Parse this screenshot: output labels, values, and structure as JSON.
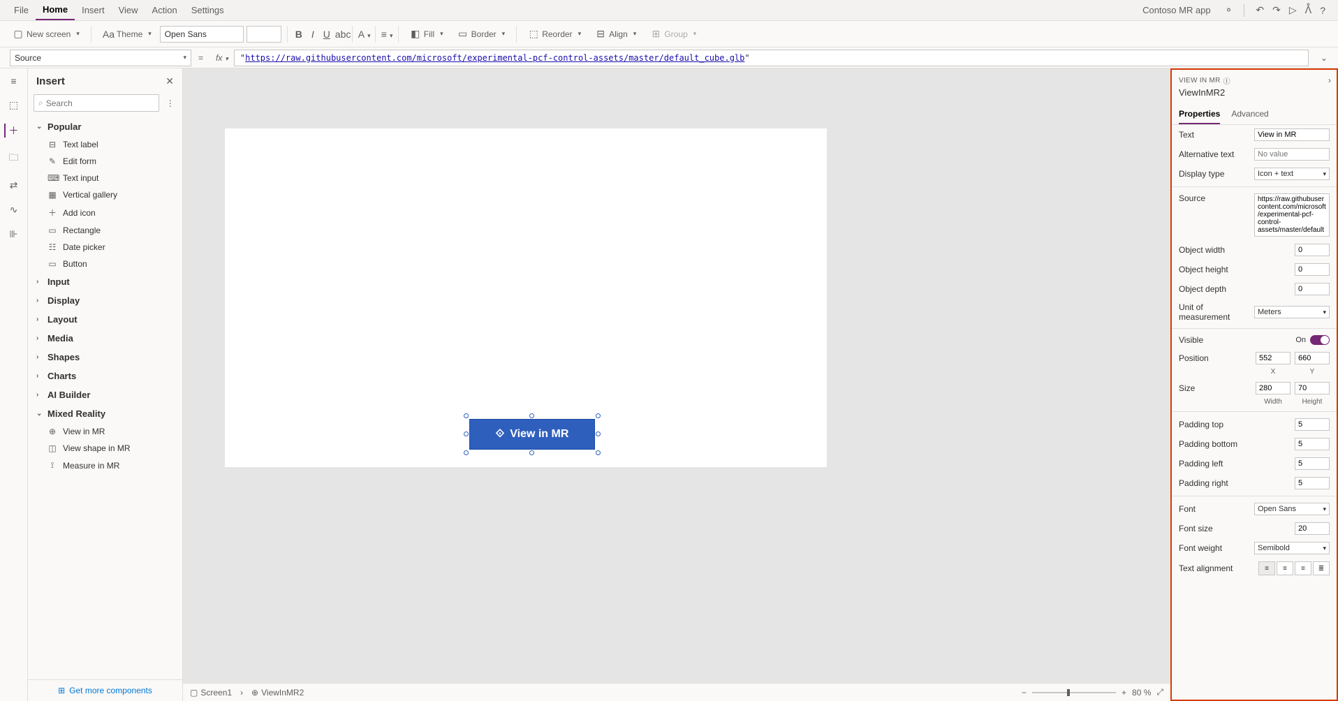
{
  "menu": {
    "items": [
      "File",
      "Home",
      "Insert",
      "View",
      "Action",
      "Settings"
    ],
    "active": "Home"
  },
  "appName": "Contoso MR app",
  "ribbon": {
    "newScreen": "New screen",
    "theme": "Theme",
    "font": "Open Sans",
    "fill": "Fill",
    "border": "Border",
    "reorder": "Reorder",
    "align": "Align",
    "group": "Group"
  },
  "formula": {
    "property": "Source",
    "value": "https://raw.githubusercontent.com/microsoft/experimental-pcf-control-assets/master/default_cube.glb"
  },
  "insert": {
    "title": "Insert",
    "searchPlaceholder": "Search",
    "popular": {
      "label": "Popular",
      "items": [
        "Text label",
        "Edit form",
        "Text input",
        "Vertical gallery",
        "Add icon",
        "Rectangle",
        "Date picker",
        "Button"
      ]
    },
    "groups": [
      "Input",
      "Display",
      "Layout",
      "Media",
      "Shapes",
      "Charts",
      "AI Builder"
    ],
    "mixedReality": {
      "label": "Mixed Reality",
      "items": [
        "View in MR",
        "View shape in MR",
        "Measure in MR"
      ]
    },
    "footer": "Get more components"
  },
  "canvasButton": {
    "label": "View in MR"
  },
  "breadcrumb": {
    "screen": "Screen1",
    "control": "ViewInMR2",
    "zoom": "80 %"
  },
  "props": {
    "type": "VIEW IN MR",
    "name": "ViewInMR2",
    "tabs": [
      "Properties",
      "Advanced"
    ],
    "text": {
      "label": "Text",
      "value": "View in MR"
    },
    "altText": {
      "label": "Alternative text",
      "placeholder": "No value"
    },
    "displayType": {
      "label": "Display type",
      "value": "Icon + text"
    },
    "source": {
      "label": "Source",
      "value": "https://raw.githubusercontent.com/microsoft/experimental-pcf-control-assets/master/default_"
    },
    "objWidth": {
      "label": "Object width",
      "value": "0"
    },
    "objHeight": {
      "label": "Object height",
      "value": "0"
    },
    "objDepth": {
      "label": "Object depth",
      "value": "0"
    },
    "unit": {
      "label": "Unit of measurement",
      "value": "Meters"
    },
    "visible": {
      "label": "Visible",
      "state": "On"
    },
    "position": {
      "label": "Position",
      "x": "552",
      "y": "660",
      "xlabel": "X",
      "ylabel": "Y"
    },
    "size": {
      "label": "Size",
      "w": "280",
      "h": "70",
      "wlabel": "Width",
      "hlabel": "Height"
    },
    "padTop": {
      "label": "Padding top",
      "value": "5"
    },
    "padBottom": {
      "label": "Padding bottom",
      "value": "5"
    },
    "padLeft": {
      "label": "Padding left",
      "value": "5"
    },
    "padRight": {
      "label": "Padding right",
      "value": "5"
    },
    "font": {
      "label": "Font",
      "value": "Open Sans"
    },
    "fontSize": {
      "label": "Font size",
      "value": "20"
    },
    "fontWeight": {
      "label": "Font weight",
      "value": "Semibold"
    },
    "textAlign": {
      "label": "Text alignment"
    }
  }
}
